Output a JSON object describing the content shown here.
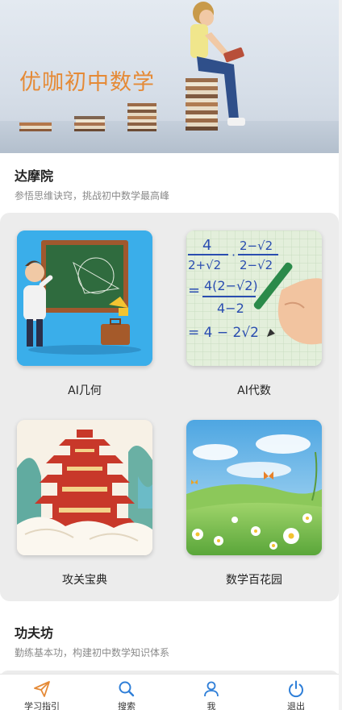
{
  "banner": {
    "title": "优咖初中数学"
  },
  "section1": {
    "title": "达摩院",
    "subtitle": "参悟思维诀窍，挑战初中数学最高峰"
  },
  "cards": [
    {
      "label": "AI几何"
    },
    {
      "label": "AI代数"
    },
    {
      "label": "攻关宝典"
    },
    {
      "label": "数学百花园"
    }
  ],
  "algebra_card": {
    "frac1_num": "4",
    "frac1_den": "2+√2",
    "frac2_num": "2−√2",
    "frac2_den": "2−√2",
    "line2_lhs": "=",
    "line2_num": "4(2−√2)",
    "line2_den": "4−2",
    "line3": "= 4 − 2√2"
  },
  "section2": {
    "title": "功夫坊",
    "subtitle": "勤练基本功，构建初中数学知识体系"
  },
  "tabbar": {
    "items": [
      {
        "label": "学习指引",
        "icon": "paper-plane-icon",
        "color": "#e58a36"
      },
      {
        "label": "搜索",
        "icon": "search-icon",
        "color": "#2f7fd8"
      },
      {
        "label": "我",
        "icon": "user-icon",
        "color": "#2f7fd8"
      },
      {
        "label": "退出",
        "icon": "power-icon",
        "color": "#2f7fd8"
      }
    ]
  }
}
